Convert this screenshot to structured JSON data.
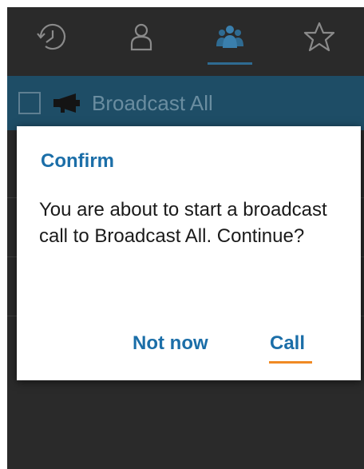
{
  "tabs": [
    {
      "icon": "history-icon",
      "active": false
    },
    {
      "icon": "contact-icon",
      "active": false
    },
    {
      "icon": "groups-icon",
      "active": true
    },
    {
      "icon": "favorites-star-icon",
      "active": false
    }
  ],
  "group": {
    "label": "Broadcast All",
    "icon": "megaphone-icon"
  },
  "dialog": {
    "title": "Confirm",
    "message": "You are about to start a broadcast call to Broadcast All. Continue?",
    "cancel_label": "Not now",
    "confirm_label": "Call"
  },
  "colors": {
    "accent": "#1b6ea8",
    "focus_underline": "#f08a24",
    "group_row": "#1e4d66",
    "background": "#2a2a2a"
  }
}
